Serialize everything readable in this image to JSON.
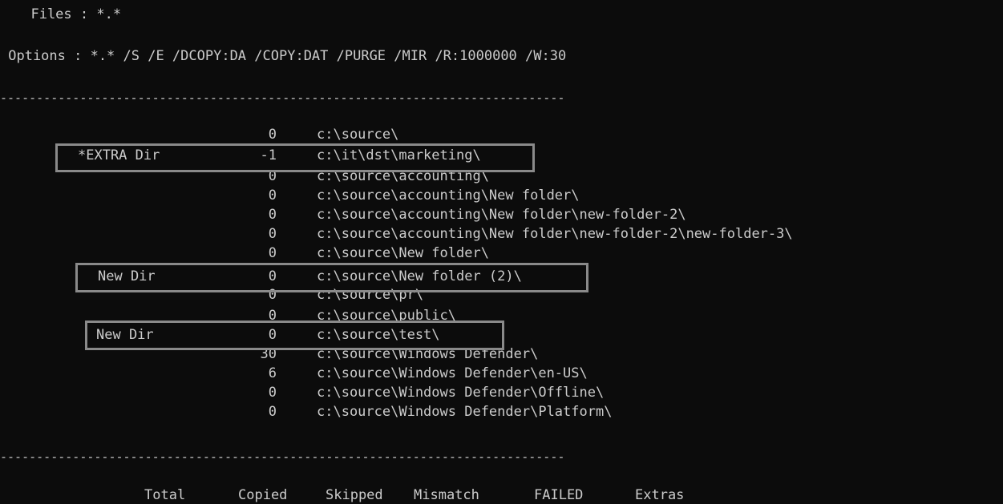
{
  "console": {
    "files_line": "  Files : *.*",
    "options_line": " Options : *.* /S /E /DCOPY:DA /COPY:DAT /PURGE /MIR /R:1000000 /W:30",
    "separator": "------------------------------------------------------------------------------",
    "rows": [
      {
        "status": "",
        "count": "0",
        "path": "c:\\source\\"
      },
      {
        "status": "*EXTRA Dir",
        "count": "-1",
        "path": "c:\\it\\dst\\marketing\\"
      },
      {
        "status": "",
        "count": "0",
        "path": "c:\\source\\accounting\\"
      },
      {
        "status": "",
        "count": "0",
        "path": "c:\\source\\accounting\\New folder\\"
      },
      {
        "status": "",
        "count": "0",
        "path": "c:\\source\\accounting\\New folder\\new-folder-2\\"
      },
      {
        "status": "",
        "count": "0",
        "path": "c:\\source\\accounting\\New folder\\new-folder-2\\new-folder-3\\"
      },
      {
        "status": "",
        "count": "0",
        "path": "c:\\source\\New folder\\"
      },
      {
        "status": "New Dir",
        "count": "0",
        "path": "c:\\source\\New folder (2)\\"
      },
      {
        "status": "",
        "count": "0",
        "path": "c:\\source\\pr\\"
      },
      {
        "status": "",
        "count": "0",
        "path": "c:\\source\\public\\"
      },
      {
        "status": "New Dir",
        "count": "0",
        "path": "c:\\source\\test\\"
      },
      {
        "status": "",
        "count": "30",
        "path": "c:\\source\\Windows Defender\\"
      },
      {
        "status": "",
        "count": "6",
        "path": "c:\\source\\Windows Defender\\en-US\\"
      },
      {
        "status": "",
        "count": "0",
        "path": "c:\\source\\Windows Defender\\Offline\\"
      },
      {
        "status": "",
        "count": "0",
        "path": "c:\\source\\Windows Defender\\Platform\\"
      }
    ],
    "summary_headers": [
      "Total",
      "Copied",
      "Skipped",
      "Mismatch",
      "FAILED",
      "Extras"
    ]
  },
  "colors": {
    "background": "#0c0c0c",
    "text": "#cccccc",
    "highlight_border": "#8a8a8a"
  }
}
